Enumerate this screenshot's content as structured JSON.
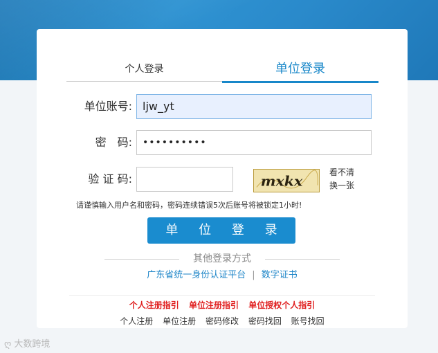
{
  "tabs": {
    "personal": "个人登录",
    "unit": "单位登录"
  },
  "form": {
    "account_label": "单位账号:",
    "account_value": "ljw_yt",
    "password_label": "密　码:",
    "password_value": "••••••••••",
    "captcha_label": "验 证 码:",
    "captcha_value": "",
    "captcha_image_text": "mxkx",
    "captcha_refresh": "看不清换一张"
  },
  "warning": "请谨慎输入用户名和密码，密码连续错误5次后账号将被锁定1小时!",
  "login_button": "单 位 登 录",
  "other": {
    "heading": "其他登录方式",
    "links": [
      "广东省统一身份认证平台",
      "数字证书"
    ],
    "separator": "|"
  },
  "guides": [
    "个人注册指引",
    "单位注册指引",
    "单位授权个人指引"
  ],
  "bottom_links": [
    "个人注册",
    "单位注册",
    "密码修改",
    "密码找回",
    "账号找回"
  ],
  "watermark": "大数跨境",
  "colors": {
    "accent": "#1a8ccf",
    "guide_red": "#e02020",
    "link_blue": "#1f86c8"
  }
}
